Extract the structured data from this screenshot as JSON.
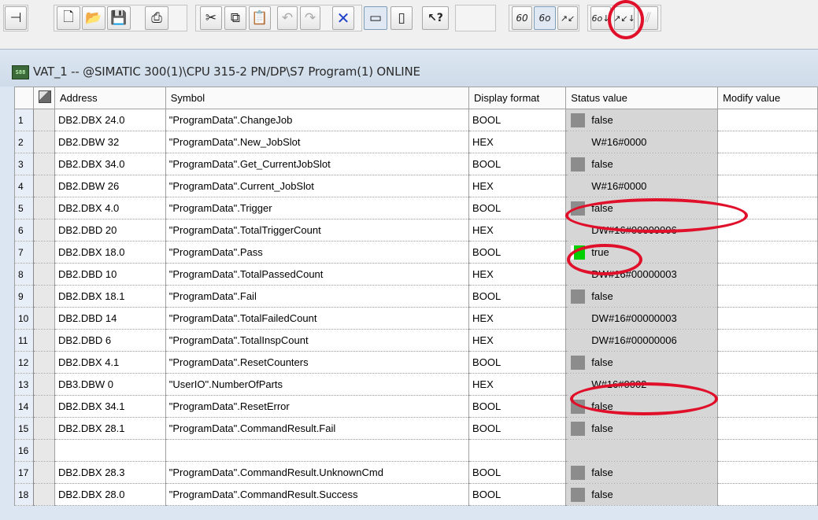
{
  "toolbar": {
    "buttons": [
      {
        "name": "pin-icon",
        "glyph": "⊣"
      },
      {
        "name": "new-document-icon",
        "glyph": "🗋"
      },
      {
        "name": "open-folder-icon",
        "glyph": "📂"
      },
      {
        "name": "save-icon",
        "glyph": "💾"
      },
      {
        "name": "print-icon",
        "glyph": "⎙"
      },
      {
        "name": "cut-icon",
        "glyph": "✂"
      },
      {
        "name": "copy-icon",
        "glyph": "⧉"
      },
      {
        "name": "paste-icon",
        "glyph": "📋"
      },
      {
        "name": "undo-icon",
        "glyph": "↶"
      },
      {
        "name": "redo-icon",
        "glyph": "↷"
      },
      {
        "name": "delete-icon",
        "glyph": "✕"
      },
      {
        "name": "monitor-pc-icon",
        "glyph": "▭"
      },
      {
        "name": "plc-icon",
        "glyph": "▯"
      },
      {
        "name": "help-icon",
        "glyph": "↖?"
      },
      {
        "name": "monitor-variable-icon",
        "glyph": "60"
      },
      {
        "name": "monitor-trigger-icon",
        "glyph": "6o"
      },
      {
        "name": "modify-variable-icon",
        "glyph": "↗↙"
      },
      {
        "name": "monitor-immediately-icon",
        "glyph": "6o↓"
      },
      {
        "name": "modify-immediately-icon",
        "glyph": "↗↙↓"
      },
      {
        "name": "force-icon",
        "glyph": "⫽"
      }
    ]
  },
  "window": {
    "icon_text": "S88",
    "title": "VAT_1 -- @SIMATIC 300(1)\\CPU 315-2 PN/DP\\S7 Program(1)  ONLINE"
  },
  "table": {
    "headers": {
      "address": "Address",
      "symbol": "Symbol",
      "display_format": "Display format",
      "status_value": "Status value",
      "modify_value": "Modify value"
    },
    "rows": [
      {
        "num": "1",
        "address": "DB2.DBX  24.0",
        "symbol": "\"ProgramData\".ChangeJob",
        "format": "BOOL",
        "status": "false",
        "indicator": "off"
      },
      {
        "num": "2",
        "address": "DB2.DBW  32",
        "symbol": "\"ProgramData\".New_JobSlot",
        "format": "HEX",
        "status": "W#16#0000",
        "indicator": "none"
      },
      {
        "num": "3",
        "address": "DB2.DBX  34.0",
        "symbol": "\"ProgramData\".Get_CurrentJobSlot",
        "format": "BOOL",
        "status": "false",
        "indicator": "off"
      },
      {
        "num": "4",
        "address": "DB2.DBW  26",
        "symbol": "\"ProgramData\".Current_JobSlot",
        "format": "HEX",
        "status": "W#16#0000",
        "indicator": "none"
      },
      {
        "num": "5",
        "address": "DB2.DBX  4.0",
        "symbol": "\"ProgramData\".Trigger",
        "format": "BOOL",
        "status": "false",
        "indicator": "off"
      },
      {
        "num": "6",
        "address": "DB2.DBD  20",
        "symbol": "\"ProgramData\".TotalTriggerCount",
        "format": "HEX",
        "status": "DW#16#00000006",
        "indicator": "none"
      },
      {
        "num": "7",
        "address": "DB2.DBX  18.0",
        "symbol": "\"ProgramData\".Pass",
        "format": "BOOL",
        "status": "true",
        "indicator": "on"
      },
      {
        "num": "8",
        "address": "DB2.DBD  10",
        "symbol": "\"ProgramData\".TotalPassedCount",
        "format": "HEX",
        "status": "DW#16#00000003",
        "indicator": "none"
      },
      {
        "num": "9",
        "address": "DB2.DBX  18.1",
        "symbol": "\"ProgramData\".Fail",
        "format": "BOOL",
        "status": "false",
        "indicator": "off"
      },
      {
        "num": "10",
        "address": "DB2.DBD  14",
        "symbol": "\"ProgramData\".TotalFailedCount",
        "format": "HEX",
        "status": "DW#16#00000003",
        "indicator": "none"
      },
      {
        "num": "11",
        "address": "DB2.DBD  6",
        "symbol": "\"ProgramData\".TotalInspCount",
        "format": "HEX",
        "status": "DW#16#00000006",
        "indicator": "none"
      },
      {
        "num": "12",
        "address": "DB2.DBX  4.1",
        "symbol": "\"ProgramData\".ResetCounters",
        "format": "BOOL",
        "status": "false",
        "indicator": "off"
      },
      {
        "num": "13",
        "address": "DB3.DBW  0",
        "symbol": "\"UserIO\".NumberOfParts",
        "format": "HEX",
        "status": "W#16#0002",
        "indicator": "none"
      },
      {
        "num": "14",
        "address": "DB2.DBX  34.1",
        "symbol": "\"ProgramData\".ResetError",
        "format": "BOOL",
        "status": "false",
        "indicator": "off"
      },
      {
        "num": "15",
        "address": "DB2.DBX  28.1",
        "symbol": "\"ProgramData\".CommandResult.Fail",
        "format": "BOOL",
        "status": "false",
        "indicator": "off"
      },
      {
        "num": "16",
        "address": "",
        "symbol": "",
        "format": "",
        "status": "",
        "indicator": "none"
      },
      {
        "num": "17",
        "address": "DB2.DBX  28.3",
        "symbol": "\"ProgramData\".CommandResult.UnknownCmd",
        "format": "BOOL",
        "status": "false",
        "indicator": "off"
      },
      {
        "num": "18",
        "address": "DB2.DBX  28.0",
        "symbol": "\"ProgramData\".CommandResult.Success",
        "format": "BOOL",
        "status": "false",
        "indicator": "off"
      }
    ]
  },
  "colors": {
    "annotation": "#e0102a",
    "indicator_on": "#00d000",
    "indicator_off": "#8c8c8c"
  }
}
